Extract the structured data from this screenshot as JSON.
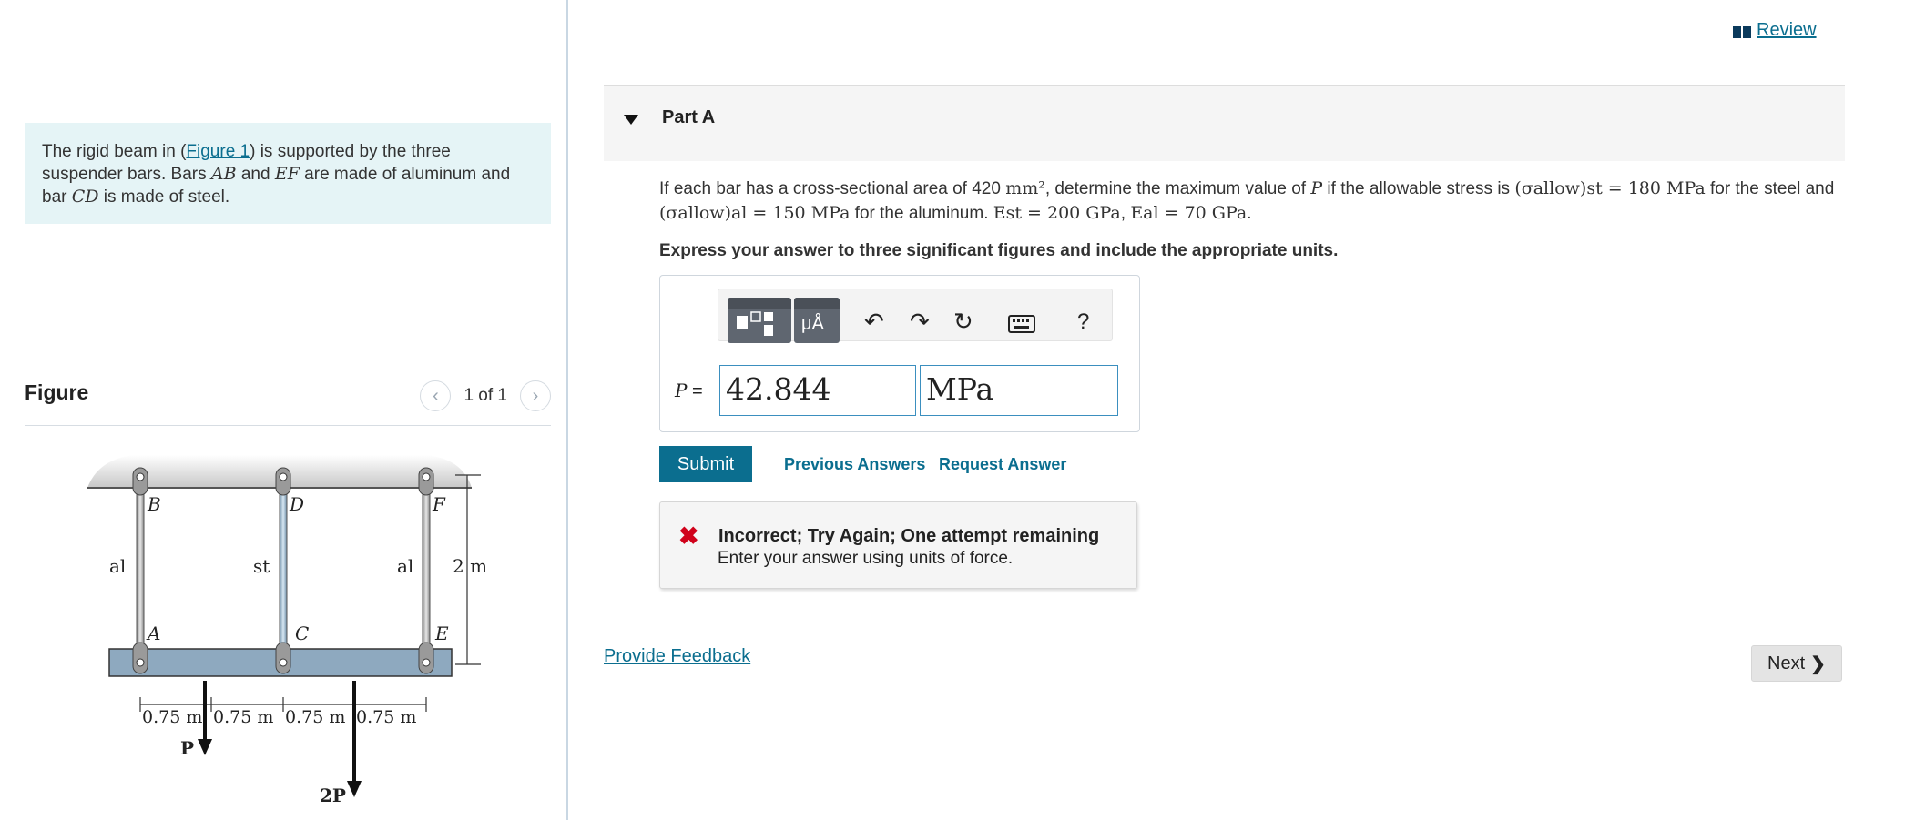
{
  "problem": {
    "t1": "The rigid beam in (",
    "link": "Figure 1",
    "t2": ") is supported by the three suspender bars. Bars ",
    "m1": "AB",
    "t3": " and ",
    "m2": "EF",
    "t4": " are made of aluminum and bar ",
    "m3": "CD",
    "t5": " is made of steel."
  },
  "figure": {
    "title": "Figure",
    "count": "1 of 1",
    "labels": {
      "B": "B",
      "D": "D",
      "F": "F",
      "A": "A",
      "C": "C",
      "E": "E",
      "al_left": "al",
      "st": "st",
      "al_right": "al",
      "height": "2 m",
      "seg1": "0.75 m",
      "seg2": "0.75 m",
      "seg3": "0.75 m",
      "seg4": "0.75 m",
      "load1": "P",
      "load2": "2P"
    }
  },
  "review": "Review",
  "part": {
    "title": "Part A"
  },
  "question": {
    "q1": "If each bar has a cross-sectional area of 420 ",
    "area_unit": "mm²",
    "q2": ", determine the maximum value of ",
    "P": "P",
    "q3": " if the allowable stress is ",
    "sigma_st": "(σallow)st = 180 MPa",
    "q4": " for the steel and ",
    "sigma_al": "(σallow)al = 150 MPa",
    "q5": " for the aluminum. ",
    "Est": "Est = 200 GPa",
    "comma": ", ",
    "Eal": "Eal = 70 GPa",
    "end": "."
  },
  "instruction": "Express your answer to three significant figures and include the appropriate units.",
  "answer": {
    "label_var": "P",
    "label_eq": " =",
    "value": "42.844",
    "units": "MPa",
    "toolbar": {
      "tile2_text": "μÅ",
      "help": "?"
    }
  },
  "actions": {
    "submit": "Submit",
    "previous": "Previous Answers",
    "request": "Request Answer"
  },
  "feedback": {
    "icon": "✖",
    "title": "Incorrect; Try Again; One attempt remaining",
    "message": "Enter your answer using units of force."
  },
  "footer": {
    "provide_feedback": "Provide Feedback",
    "next": "Next"
  },
  "colors": {
    "accent": "#0b6e8f",
    "error": "#d0021b",
    "problem_bg": "#e5f4f6"
  }
}
